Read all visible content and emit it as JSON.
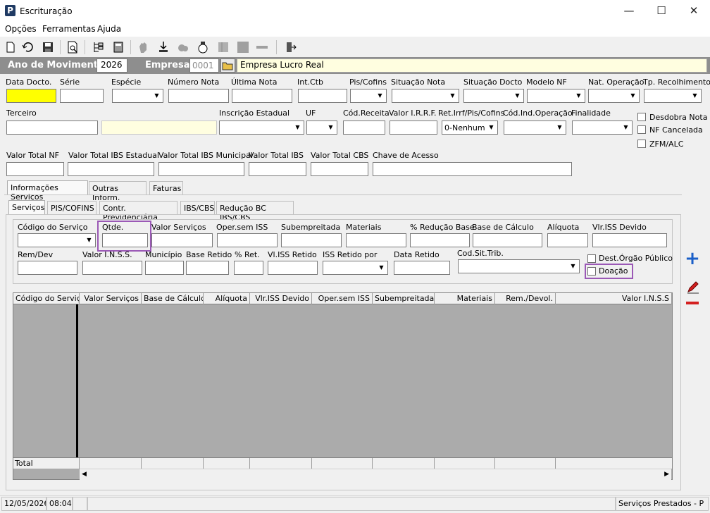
{
  "window": {
    "title": "Escrituração",
    "minimize": "—",
    "maximize": "☐",
    "close": "✕"
  },
  "menu": [
    "Opções",
    "Ferramentas",
    "Ajuda"
  ],
  "header": {
    "ano_label": "Ano de Movimento",
    "ano_value": "2026",
    "empresa_label": "Empresa",
    "empresa_code": "0001",
    "empresa_name": "Empresa Lucro Real"
  },
  "row1": {
    "data_docto": "Data Docto.",
    "serie": "Série",
    "especie": "Espécie",
    "numero_nota": "Número Nota",
    "ultima_nota": "Última Nota",
    "int_ctb": "Int.Ctb",
    "pis_cofins": "Pis/Cofins",
    "situacao_nota": "Situação Nota",
    "situacao_docto": "Situação Docto",
    "modelo_nf": "Modelo NF",
    "nat_operacao": "Nat. Operação",
    "tp_recolhimento": "Tp. Recolhimento"
  },
  "row2": {
    "terceiro": "Terceiro",
    "inscricao_estadual": "Inscrição Estadual",
    "uf": "UF",
    "cod_receita": "Cód.Receita",
    "valor_irrf": "Valor I.R.R.F.",
    "ret_irrf": "Ret.Irrf/Pis/Cofins",
    "ret_irrf_value": "0-Nenhum",
    "cod_ind_operacao": "Cód.Ind.Operação",
    "finalidade": "Finalidade"
  },
  "checks_right": {
    "desdobra": "Desdobra Nota",
    "cancelada": "NF Cancelada",
    "zfm": "ZFM/ALC"
  },
  "row3": {
    "valor_total_nf": "Valor Total NF",
    "ibs_estadual": "Valor Total IBS Estadual",
    "ibs_municipal": "Valor Total IBS Municipal",
    "ibs": "Valor Total IBS",
    "cbs": "Valor Total CBS",
    "chave": "Chave de Acesso"
  },
  "tabs_main": [
    "Informações Serviços",
    "Outras Inform.",
    "Faturas"
  ],
  "tabs_sub": [
    "Serviços",
    "PIS/COFINS",
    "Contr. Previdenciária",
    "IBS/CBS",
    "Redução BC IBS/CBS"
  ],
  "services": {
    "cod_servico": "Código do Serviço",
    "qtde": "Qtde.",
    "valor_servicos": "Valor Serviços",
    "oper_sem_iss": "Oper.sem ISS",
    "subempreitada": "Subempreitada",
    "materiais": "Materiais",
    "reducao_base": "% Redução Base",
    "base_calculo": "Base de Cálculo",
    "aliquota": "Alíquota",
    "vlr_iss_devido": "Vlr.ISS Devido",
    "rem_dev": "Rem/Dev",
    "valor_inss": "Valor I.N.S.S.",
    "municipio": "Município",
    "base_retido": "Base Retido",
    "perc_ret": "% Ret.",
    "vl_iss_retido": "Vl.ISS Retido",
    "iss_retido_por": "ISS Retido por",
    "data_retido": "Data Retido",
    "cod_sit_trib": "Cod.Sit.Trib.",
    "dest_orgao": "Dest.Órgão Público",
    "doacao": "Doação"
  },
  "grid": {
    "columns": [
      "Código do Serviço",
      "Valor Serviços",
      "Base de Cálculo",
      "Alíquota",
      "Vlr.ISS Devido",
      "Oper.sem ISS",
      "Subempreitada",
      "Materiais",
      "Rem./Devol.",
      "Valor I.N.S.S"
    ],
    "total_label": "Total"
  },
  "status": {
    "date": "12/05/2026",
    "time": "08:04",
    "module": "Serviços Prestados - P"
  },
  "colors": {
    "header_bg": "#8e8e8e",
    "yellow_field": "#ffff00",
    "highlight": "#9b59b6",
    "add": "#1a5fc8",
    "remove": "#d42020"
  }
}
